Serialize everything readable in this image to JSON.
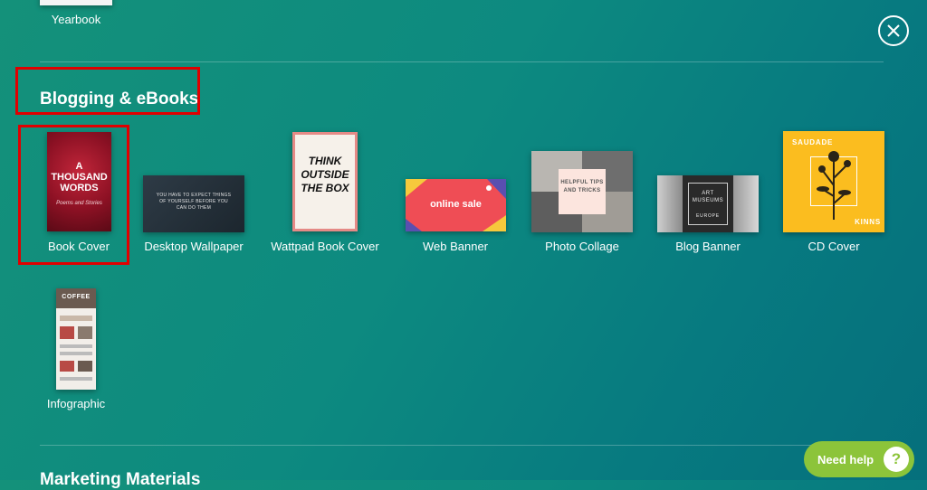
{
  "top_section": {
    "last_item_label": "Yearbook"
  },
  "section": {
    "title": "Blogging & eBooks",
    "items": [
      {
        "label": "Book Cover",
        "thumb_title": "A THOUSAND WORDS",
        "thumb_sub": "Poems and Stories"
      },
      {
        "label": "Desktop Wallpaper",
        "thumb_text": "YOU HAVE TO EXPECT THINGS OF YOURSELF BEFORE YOU CAN DO THEM"
      },
      {
        "label": "Wattpad Book Cover",
        "thumb_title": "THINK OUTSIDE THE BOX"
      },
      {
        "label": "Web Banner",
        "thumb_title": "online sale"
      },
      {
        "label": "Photo Collage",
        "thumb_title": "HELPFUL TIPS AND TRICKS"
      },
      {
        "label": "Blog Banner",
        "thumb_title": "ART MUSEUMS",
        "thumb_sub": "EUROPE"
      },
      {
        "label": "CD Cover",
        "thumb_title": "SAUDADE",
        "thumb_sub": "KINNS"
      },
      {
        "label": "Infographic",
        "thumb_title": "COFFEE"
      }
    ]
  },
  "next_section": {
    "title": "Marketing Materials"
  },
  "help": {
    "label": "Need help",
    "glyph": "?"
  },
  "colors": {
    "highlight": "#e00000",
    "help": "#8cc43a"
  }
}
